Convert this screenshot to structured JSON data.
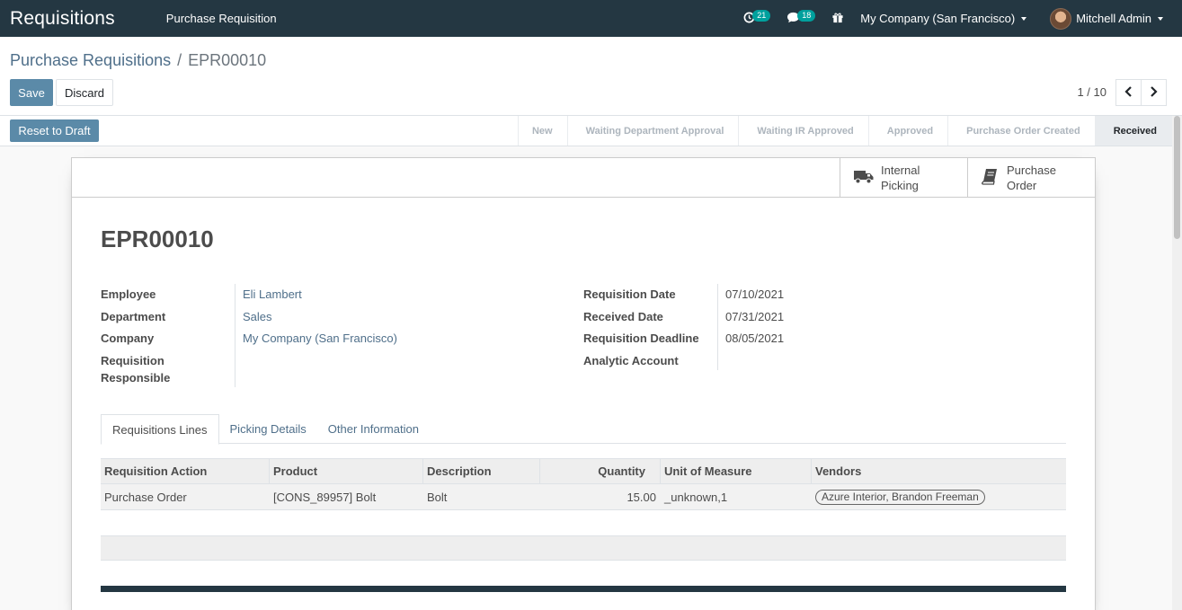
{
  "navbar": {
    "app_title": "Requisitions",
    "menu_item": "Purchase Requisition",
    "activity_count": "21",
    "message_count": "18",
    "company": "My Company (San Francisco)",
    "user": "Mitchell Admin",
    "bg_color": "#243742",
    "badge_color": "#00a09d"
  },
  "breadcrumb": {
    "parent": "Purchase Requisitions",
    "separator": "/",
    "current": "EPR00010"
  },
  "actions": {
    "save": "Save",
    "discard": "Discard",
    "reset_to_draft": "Reset to Draft",
    "primary_color": "#5b8aa8"
  },
  "pager": {
    "value": "1 / 10"
  },
  "stages": [
    {
      "label": "New"
    },
    {
      "label": "Waiting Department Approval"
    },
    {
      "label": "Waiting IR Approved"
    },
    {
      "label": "Approved"
    },
    {
      "label": "Purchase Order Created"
    },
    {
      "label": "Received",
      "active": true
    }
  ],
  "smart_buttons": {
    "picking_line1": "Internal",
    "picking_line2": "Picking",
    "order_line1": "Purchase",
    "order_line2": "Order"
  },
  "record": {
    "title": "EPR00010",
    "left_fields": {
      "employee_label": "Employee",
      "employee_value": "Eli Lambert",
      "department_label": "Department",
      "department_value": "Sales",
      "company_label": "Company",
      "company_value": "My Company (San Francisco)",
      "responsible_label_1": "Requisition",
      "responsible_label_2": "Responsible"
    },
    "right_fields": {
      "req_date_label": "Requisition Date",
      "req_date_value": "07/10/2021",
      "received_label": "Received Date",
      "received_value": "07/31/2021",
      "deadline_label": "Requisition Deadline",
      "deadline_value": "08/05/2021",
      "analytic_label": "Analytic Account"
    }
  },
  "tabs": [
    {
      "label": "Requisitions Lines",
      "active": true
    },
    {
      "label": "Picking Details"
    },
    {
      "label": "Other Information"
    }
  ],
  "lines": {
    "columns": [
      "Requisition Action",
      "Product",
      "Description",
      "Quantity",
      "Unit of Measure",
      "Vendors"
    ],
    "rows": [
      {
        "action": "Purchase Order",
        "product": "[CONS_89957] Bolt",
        "description": "Bolt",
        "quantity": "15.00",
        "uom": "_unknown,1",
        "vendors": "Azure Interior, Brandon Freeman"
      }
    ]
  }
}
